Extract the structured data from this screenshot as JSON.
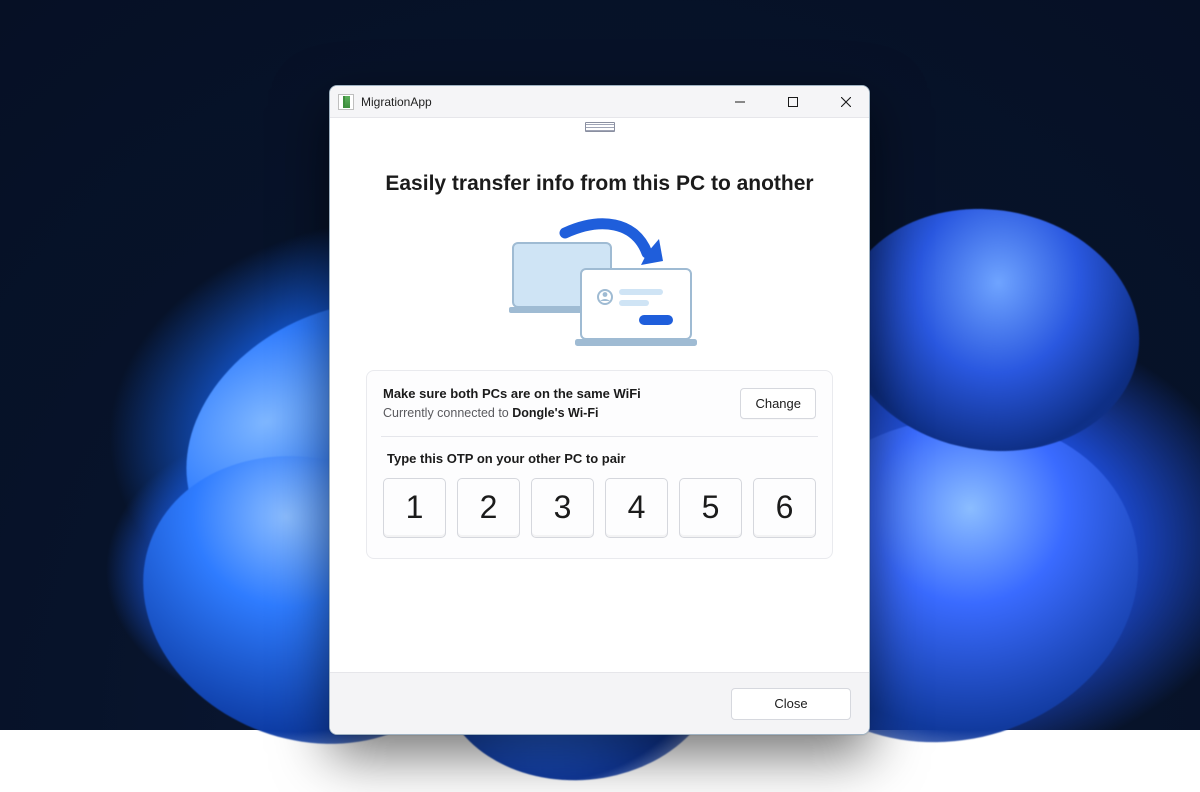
{
  "window": {
    "title": "MigrationApp"
  },
  "headline": "Easily transfer info from this PC to another",
  "wifi": {
    "heading": "Make sure both PCs are on the same WiFi",
    "prefix": "Currently connected to ",
    "ssid": "Dongle's Wi-Fi",
    "change_label": "Change"
  },
  "otp": {
    "heading": "Type this OTP on your other PC to pair",
    "digits": [
      "1",
      "2",
      "3",
      "4",
      "5",
      "6"
    ]
  },
  "footer": {
    "close_label": "Close"
  },
  "colors": {
    "accent": "#1f5edb",
    "window_bg": "#ffffff",
    "footer_bg": "#f4f4f6"
  }
}
